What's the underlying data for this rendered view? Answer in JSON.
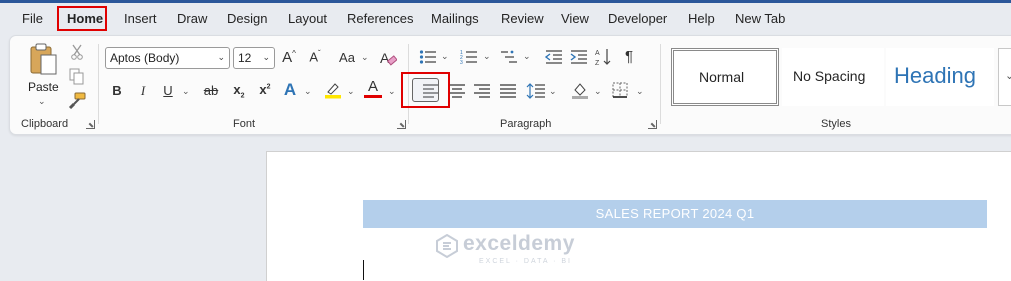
{
  "menu": {
    "tabs": [
      "File",
      "Home",
      "Insert",
      "Draw",
      "Design",
      "Layout",
      "References",
      "Mailings",
      "Review",
      "View",
      "Developer",
      "Help",
      "New Tab"
    ],
    "active": "Home"
  },
  "clipboard": {
    "paste_label": "Paste",
    "group_label": "Clipboard"
  },
  "font": {
    "font_name": "Aptos (Body)",
    "font_size": "12",
    "group_label": "Font",
    "bold": "B",
    "italic": "I",
    "underline": "U",
    "strike": "ab",
    "subscript": "x",
    "superscript": "x",
    "change_case": "Aa",
    "grow": "A",
    "shrink": "A",
    "text_effects": "A",
    "font_color": "A",
    "highlight_color": "#ffe600",
    "font_color_value": "#e00000"
  },
  "paragraph": {
    "group_label": "Paragraph",
    "pilcrow": "¶"
  },
  "styles": {
    "group_label": "Styles",
    "normal": "Normal",
    "no_spacing": "No Spacing",
    "heading": "Heading"
  },
  "document": {
    "title": "SALES REPORT 2024 Q1",
    "watermark_name": "exceldemy",
    "watermark_sub": "EXCEL · DATA · BI"
  },
  "colors": {
    "accent": "#2b579a",
    "highlight_box": "#e00000",
    "title_bar": "#b4cfeb",
    "heading_style": "#2e74b5"
  }
}
